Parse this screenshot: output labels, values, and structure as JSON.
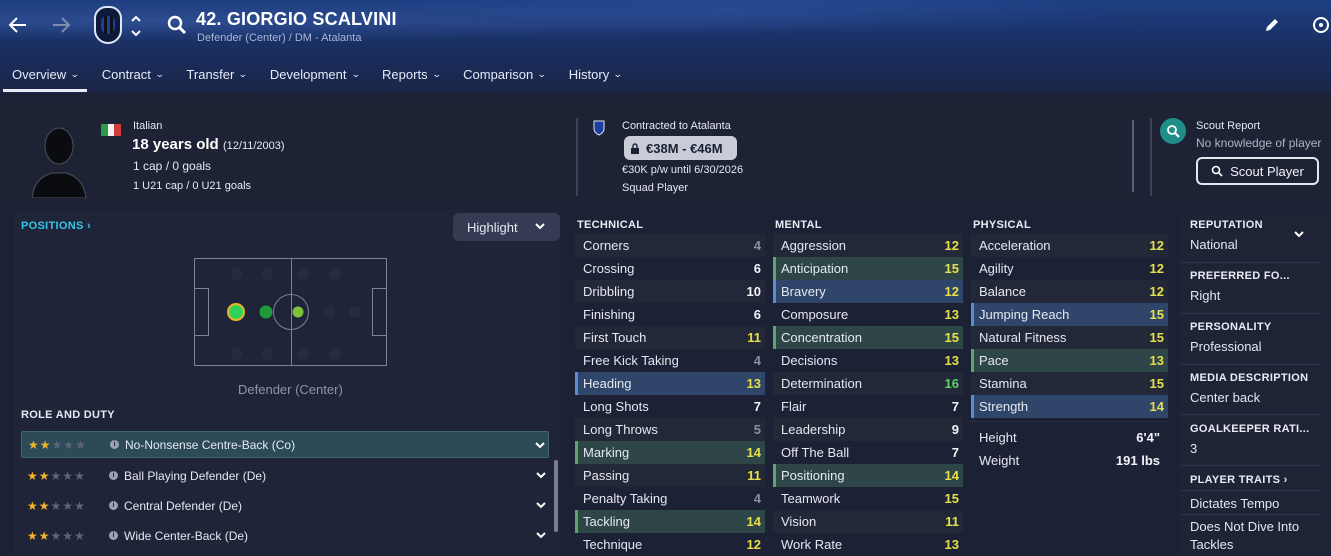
{
  "header": {
    "player_title": "42. GIORGIO SCALVINI",
    "subtitle": "Defender (Center) / DM - Atalanta",
    "tabs": [
      "Overview",
      "Contract",
      "Transfer",
      "Development",
      "Reports",
      "Comparison",
      "History"
    ],
    "active_tab": "Overview"
  },
  "profile": {
    "nationality": "Italian",
    "age": "18 years old",
    "dob": "(12/11/2003)",
    "caps": "1 cap / 0 goals",
    "u21_caps": "1 U21 cap / 0 U21 goals"
  },
  "contract": {
    "club_text": "Contracted to Atalanta",
    "value_range": "€38M - €46M",
    "wage": "€30K p/w until 6/30/2026",
    "status": "Squad Player"
  },
  "scout": {
    "title": "Scout Report",
    "note": "No knowledge of player",
    "button": "Scout Player"
  },
  "positions": {
    "heading": "POSITIONS",
    "highlight_label": "Highlight",
    "position_label": "Defender (Center)"
  },
  "roles": {
    "heading": "ROLE AND DUTY",
    "items": [
      {
        "label": "No-Nonsense Centre-Back (Co)",
        "stars": 2,
        "selected": true
      },
      {
        "label": "Ball Playing Defender (De)",
        "stars": 2,
        "selected": false
      },
      {
        "label": "Central Defender (De)",
        "stars": 2,
        "selected": false
      },
      {
        "label": "Wide Center-Back (De)",
        "stars": 2,
        "selected": false
      }
    ]
  },
  "technical": {
    "heading": "TECHNICAL",
    "rows": [
      {
        "name": "Corners",
        "value": "4",
        "tone": "g",
        "hl": ""
      },
      {
        "name": "Crossing",
        "value": "6",
        "tone": "w",
        "hl": ""
      },
      {
        "name": "Dribbling",
        "value": "10",
        "tone": "w",
        "hl": ""
      },
      {
        "name": "Finishing",
        "value": "6",
        "tone": "w",
        "hl": ""
      },
      {
        "name": "First Touch",
        "value": "11",
        "tone": "y",
        "hl": ""
      },
      {
        "name": "Free Kick Taking",
        "value": "4",
        "tone": "g",
        "hl": ""
      },
      {
        "name": "Heading",
        "value": "13",
        "tone": "y",
        "hl": "blue"
      },
      {
        "name": "Long Shots",
        "value": "7",
        "tone": "w",
        "hl": ""
      },
      {
        "name": "Long Throws",
        "value": "5",
        "tone": "g",
        "hl": ""
      },
      {
        "name": "Marking",
        "value": "14",
        "tone": "y",
        "hl": "green"
      },
      {
        "name": "Passing",
        "value": "11",
        "tone": "y",
        "hl": ""
      },
      {
        "name": "Penalty Taking",
        "value": "4",
        "tone": "g",
        "hl": ""
      },
      {
        "name": "Tackling",
        "value": "14",
        "tone": "y",
        "hl": "green"
      },
      {
        "name": "Technique",
        "value": "12",
        "tone": "y",
        "hl": ""
      }
    ]
  },
  "mental": {
    "heading": "MENTAL",
    "rows": [
      {
        "name": "Aggression",
        "value": "12",
        "tone": "y",
        "hl": ""
      },
      {
        "name": "Anticipation",
        "value": "15",
        "tone": "y",
        "hl": "green"
      },
      {
        "name": "Bravery",
        "value": "12",
        "tone": "y",
        "hl": "blue"
      },
      {
        "name": "Composure",
        "value": "13",
        "tone": "y",
        "hl": ""
      },
      {
        "name": "Concentration",
        "value": "15",
        "tone": "y",
        "hl": "green"
      },
      {
        "name": "Decisions",
        "value": "13",
        "tone": "y",
        "hl": ""
      },
      {
        "name": "Determination",
        "value": "16",
        "tone": "gr",
        "hl": ""
      },
      {
        "name": "Flair",
        "value": "7",
        "tone": "w",
        "hl": ""
      },
      {
        "name": "Leadership",
        "value": "9",
        "tone": "w",
        "hl": ""
      },
      {
        "name": "Off The Ball",
        "value": "7",
        "tone": "w",
        "hl": ""
      },
      {
        "name": "Positioning",
        "value": "14",
        "tone": "y",
        "hl": "green"
      },
      {
        "name": "Teamwork",
        "value": "15",
        "tone": "y",
        "hl": ""
      },
      {
        "name": "Vision",
        "value": "11",
        "tone": "y",
        "hl": ""
      },
      {
        "name": "Work Rate",
        "value": "13",
        "tone": "y",
        "hl": ""
      }
    ]
  },
  "physical": {
    "heading": "PHYSICAL",
    "rows": [
      {
        "name": "Acceleration",
        "value": "12",
        "tone": "y",
        "hl": ""
      },
      {
        "name": "Agility",
        "value": "12",
        "tone": "y",
        "hl": ""
      },
      {
        "name": "Balance",
        "value": "12",
        "tone": "y",
        "hl": ""
      },
      {
        "name": "Jumping Reach",
        "value": "15",
        "tone": "y",
        "hl": "blue"
      },
      {
        "name": "Natural Fitness",
        "value": "15",
        "tone": "y",
        "hl": ""
      },
      {
        "name": "Pace",
        "value": "13",
        "tone": "y",
        "hl": "green"
      },
      {
        "name": "Stamina",
        "value": "15",
        "tone": "y",
        "hl": ""
      },
      {
        "name": "Strength",
        "value": "14",
        "tone": "y",
        "hl": "blue"
      }
    ],
    "height_label": "Height",
    "height_value": "6'4\"",
    "weight_label": "Weight",
    "weight_value": "191 lbs"
  },
  "sidebar": {
    "reputation_h": "REPUTATION",
    "reputation_v": "National",
    "foot_h": "PREFERRED FO...",
    "foot_v": "Right",
    "personality_h": "PERSONALITY",
    "personality_v": "Professional",
    "media_h": "MEDIA DESCRIPTION",
    "media_v": "Center back",
    "gk_h": "GOALKEEPER RATI...",
    "gk_v": "3",
    "traits_h": "PLAYER TRAITS",
    "traits": [
      "Dictates Tempo",
      "Does Not Dive Into Tackles"
    ]
  },
  "colors": {
    "accent": "#35c6e8",
    "attr_high": "#e6e04a",
    "attr_top": "#5fd36a",
    "star": "#f2b52a"
  }
}
